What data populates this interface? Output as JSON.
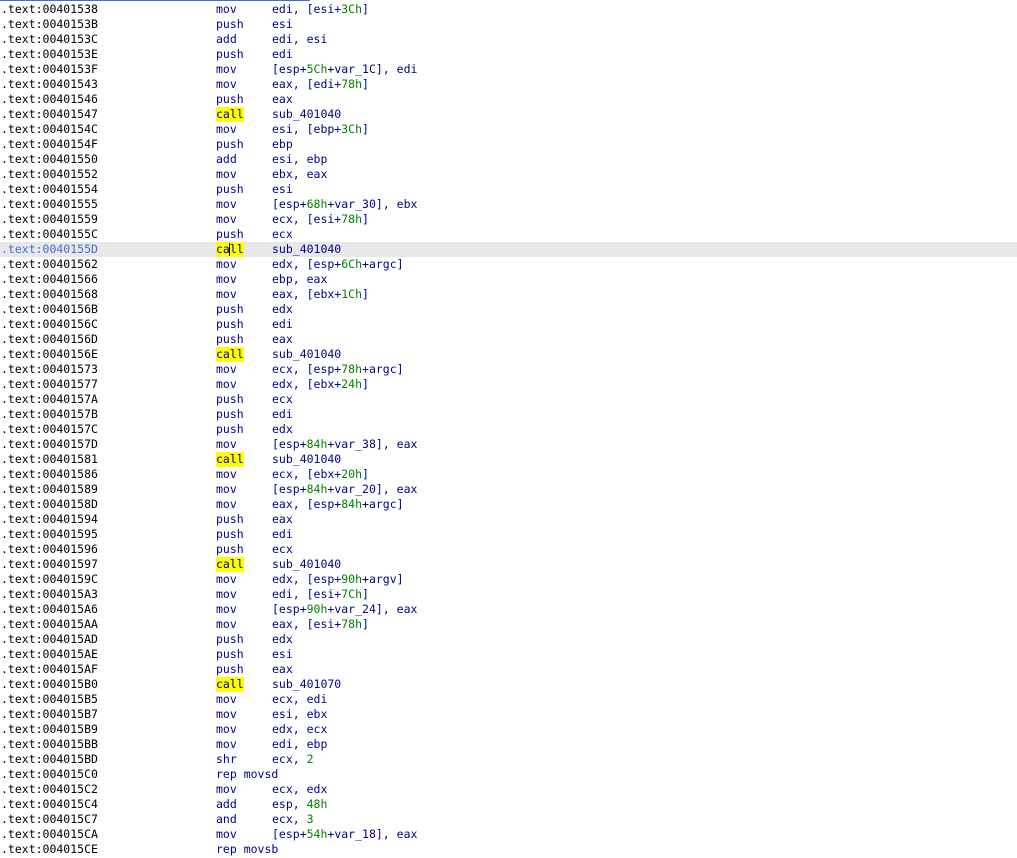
{
  "theme": {
    "address_color": "#000000",
    "code_color": "#00008b",
    "number_color": "#008000",
    "highlight_color": "#ffff00",
    "selected_row_color": "#e8e8e8",
    "selected_address_color": "#3b6fd6"
  },
  "listing": {
    "highlighted_word": "call",
    "selected_index": 16,
    "rows": [
      {
        "addr": ".text:00401538",
        "mnem": "mov",
        "ops": [
          {
            "t": "edi, [esi+"
          },
          {
            "t": "3Ch",
            "n": true
          },
          {
            "t": "]"
          }
        ]
      },
      {
        "addr": ".text:0040153B",
        "mnem": "push",
        "ops": [
          {
            "t": "esi"
          }
        ]
      },
      {
        "addr": ".text:0040153C",
        "mnem": "add",
        "ops": [
          {
            "t": "edi, esi"
          }
        ]
      },
      {
        "addr": ".text:0040153E",
        "mnem": "push",
        "ops": [
          {
            "t": "edi"
          }
        ]
      },
      {
        "addr": ".text:0040153F",
        "mnem": "mov",
        "ops": [
          {
            "t": "[esp+"
          },
          {
            "t": "5Ch",
            "n": true
          },
          {
            "t": "+var_1C], edi"
          }
        ]
      },
      {
        "addr": ".text:00401543",
        "mnem": "mov",
        "ops": [
          {
            "t": "eax, [edi+"
          },
          {
            "t": "78h",
            "n": true
          },
          {
            "t": "]"
          }
        ]
      },
      {
        "addr": ".text:00401546",
        "mnem": "push",
        "ops": [
          {
            "t": "eax"
          }
        ]
      },
      {
        "addr": ".text:00401547",
        "mnem": "call",
        "ops": [
          {
            "t": "sub_401040"
          }
        ]
      },
      {
        "addr": ".text:0040154C",
        "mnem": "mov",
        "ops": [
          {
            "t": "esi, [ebp+"
          },
          {
            "t": "3Ch",
            "n": true
          },
          {
            "t": "]"
          }
        ]
      },
      {
        "addr": ".text:0040154F",
        "mnem": "push",
        "ops": [
          {
            "t": "ebp"
          }
        ]
      },
      {
        "addr": ".text:00401550",
        "mnem": "add",
        "ops": [
          {
            "t": "esi, ebp"
          }
        ]
      },
      {
        "addr": ".text:00401552",
        "mnem": "mov",
        "ops": [
          {
            "t": "ebx, eax"
          }
        ]
      },
      {
        "addr": ".text:00401554",
        "mnem": "push",
        "ops": [
          {
            "t": "esi"
          }
        ]
      },
      {
        "addr": ".text:00401555",
        "mnem": "mov",
        "ops": [
          {
            "t": "[esp+"
          },
          {
            "t": "68h",
            "n": true
          },
          {
            "t": "+var_30], ebx"
          }
        ]
      },
      {
        "addr": ".text:00401559",
        "mnem": "mov",
        "ops": [
          {
            "t": "ecx, [esi+"
          },
          {
            "t": "78h",
            "n": true
          },
          {
            "t": "]"
          }
        ]
      },
      {
        "addr": ".text:0040155C",
        "mnem": "push",
        "ops": [
          {
            "t": "ecx"
          }
        ]
      },
      {
        "addr": ".text:0040155D",
        "mnem": "call",
        "ops": [
          {
            "t": "sub_401040"
          }
        ]
      },
      {
        "addr": ".text:00401562",
        "mnem": "mov",
        "ops": [
          {
            "t": "edx, [esp+"
          },
          {
            "t": "6Ch",
            "n": true
          },
          {
            "t": "+argc]"
          }
        ]
      },
      {
        "addr": ".text:00401566",
        "mnem": "mov",
        "ops": [
          {
            "t": "ebp, eax"
          }
        ]
      },
      {
        "addr": ".text:00401568",
        "mnem": "mov",
        "ops": [
          {
            "t": "eax, [ebx+"
          },
          {
            "t": "1Ch",
            "n": true
          },
          {
            "t": "]"
          }
        ]
      },
      {
        "addr": ".text:0040156B",
        "mnem": "push",
        "ops": [
          {
            "t": "edx"
          }
        ]
      },
      {
        "addr": ".text:0040156C",
        "mnem": "push",
        "ops": [
          {
            "t": "edi"
          }
        ]
      },
      {
        "addr": ".text:0040156D",
        "mnem": "push",
        "ops": [
          {
            "t": "eax"
          }
        ]
      },
      {
        "addr": ".text:0040156E",
        "mnem": "call",
        "ops": [
          {
            "t": "sub_401040"
          }
        ]
      },
      {
        "addr": ".text:00401573",
        "mnem": "mov",
        "ops": [
          {
            "t": "ecx, [esp+"
          },
          {
            "t": "78h",
            "n": true
          },
          {
            "t": "+argc]"
          }
        ]
      },
      {
        "addr": ".text:00401577",
        "mnem": "mov",
        "ops": [
          {
            "t": "edx, [ebx+"
          },
          {
            "t": "24h",
            "n": true
          },
          {
            "t": "]"
          }
        ]
      },
      {
        "addr": ".text:0040157A",
        "mnem": "push",
        "ops": [
          {
            "t": "ecx"
          }
        ]
      },
      {
        "addr": ".text:0040157B",
        "mnem": "push",
        "ops": [
          {
            "t": "edi"
          }
        ]
      },
      {
        "addr": ".text:0040157C",
        "mnem": "push",
        "ops": [
          {
            "t": "edx"
          }
        ]
      },
      {
        "addr": ".text:0040157D",
        "mnem": "mov",
        "ops": [
          {
            "t": "[esp+"
          },
          {
            "t": "84h",
            "n": true
          },
          {
            "t": "+var_38], eax"
          }
        ]
      },
      {
        "addr": ".text:00401581",
        "mnem": "call",
        "ops": [
          {
            "t": "sub_401040"
          }
        ]
      },
      {
        "addr": ".text:00401586",
        "mnem": "mov",
        "ops": [
          {
            "t": "ecx, [ebx+"
          },
          {
            "t": "20h",
            "n": true
          },
          {
            "t": "]"
          }
        ]
      },
      {
        "addr": ".text:00401589",
        "mnem": "mov",
        "ops": [
          {
            "t": "[esp+"
          },
          {
            "t": "84h",
            "n": true
          },
          {
            "t": "+var_20], eax"
          }
        ]
      },
      {
        "addr": ".text:0040158D",
        "mnem": "mov",
        "ops": [
          {
            "t": "eax, [esp+"
          },
          {
            "t": "84h",
            "n": true
          },
          {
            "t": "+argc]"
          }
        ]
      },
      {
        "addr": ".text:00401594",
        "mnem": "push",
        "ops": [
          {
            "t": "eax"
          }
        ]
      },
      {
        "addr": ".text:00401595",
        "mnem": "push",
        "ops": [
          {
            "t": "edi"
          }
        ]
      },
      {
        "addr": ".text:00401596",
        "mnem": "push",
        "ops": [
          {
            "t": "ecx"
          }
        ]
      },
      {
        "addr": ".text:00401597",
        "mnem": "call",
        "ops": [
          {
            "t": "sub_401040"
          }
        ]
      },
      {
        "addr": ".text:0040159C",
        "mnem": "mov",
        "ops": [
          {
            "t": "edx, [esp+"
          },
          {
            "t": "90h",
            "n": true
          },
          {
            "t": "+argv]"
          }
        ]
      },
      {
        "addr": ".text:004015A3",
        "mnem": "mov",
        "ops": [
          {
            "t": "edi, [esi+"
          },
          {
            "t": "7Ch",
            "n": true
          },
          {
            "t": "]"
          }
        ]
      },
      {
        "addr": ".text:004015A6",
        "mnem": "mov",
        "ops": [
          {
            "t": "[esp+"
          },
          {
            "t": "90h",
            "n": true
          },
          {
            "t": "+var_24], eax"
          }
        ]
      },
      {
        "addr": ".text:004015AA",
        "mnem": "mov",
        "ops": [
          {
            "t": "eax, [esi+"
          },
          {
            "t": "78h",
            "n": true
          },
          {
            "t": "]"
          }
        ]
      },
      {
        "addr": ".text:004015AD",
        "mnem": "push",
        "ops": [
          {
            "t": "edx"
          }
        ]
      },
      {
        "addr": ".text:004015AE",
        "mnem": "push",
        "ops": [
          {
            "t": "esi"
          }
        ]
      },
      {
        "addr": ".text:004015AF",
        "mnem": "push",
        "ops": [
          {
            "t": "eax"
          }
        ]
      },
      {
        "addr": ".text:004015B0",
        "mnem": "call",
        "ops": [
          {
            "t": "sub_401070"
          }
        ]
      },
      {
        "addr": ".text:004015B5",
        "mnem": "mov",
        "ops": [
          {
            "t": "ecx, edi"
          }
        ]
      },
      {
        "addr": ".text:004015B7",
        "mnem": "mov",
        "ops": [
          {
            "t": "esi, ebx"
          }
        ]
      },
      {
        "addr": ".text:004015B9",
        "mnem": "mov",
        "ops": [
          {
            "t": "edx, ecx"
          }
        ]
      },
      {
        "addr": ".text:004015BB",
        "mnem": "mov",
        "ops": [
          {
            "t": "edi, ebp"
          }
        ]
      },
      {
        "addr": ".text:004015BD",
        "mnem": "shr",
        "ops": [
          {
            "t": "ecx, "
          },
          {
            "t": "2",
            "n": true
          }
        ]
      },
      {
        "addr": ".text:004015C0",
        "mnem": "rep movsd",
        "ops": []
      },
      {
        "addr": ".text:004015C2",
        "mnem": "mov",
        "ops": [
          {
            "t": "ecx, edx"
          }
        ]
      },
      {
        "addr": ".text:004015C4",
        "mnem": "add",
        "ops": [
          {
            "t": "esp, "
          },
          {
            "t": "48h",
            "n": true
          }
        ]
      },
      {
        "addr": ".text:004015C7",
        "mnem": "and",
        "ops": [
          {
            "t": "ecx, "
          },
          {
            "t": "3",
            "n": true
          }
        ]
      },
      {
        "addr": ".text:004015CA",
        "mnem": "mov",
        "ops": [
          {
            "t": "[esp+"
          },
          {
            "t": "54h",
            "n": true
          },
          {
            "t": "+var_18], eax"
          }
        ]
      },
      {
        "addr": ".text:004015CE",
        "mnem": "rep movsb",
        "ops": []
      }
    ]
  }
}
